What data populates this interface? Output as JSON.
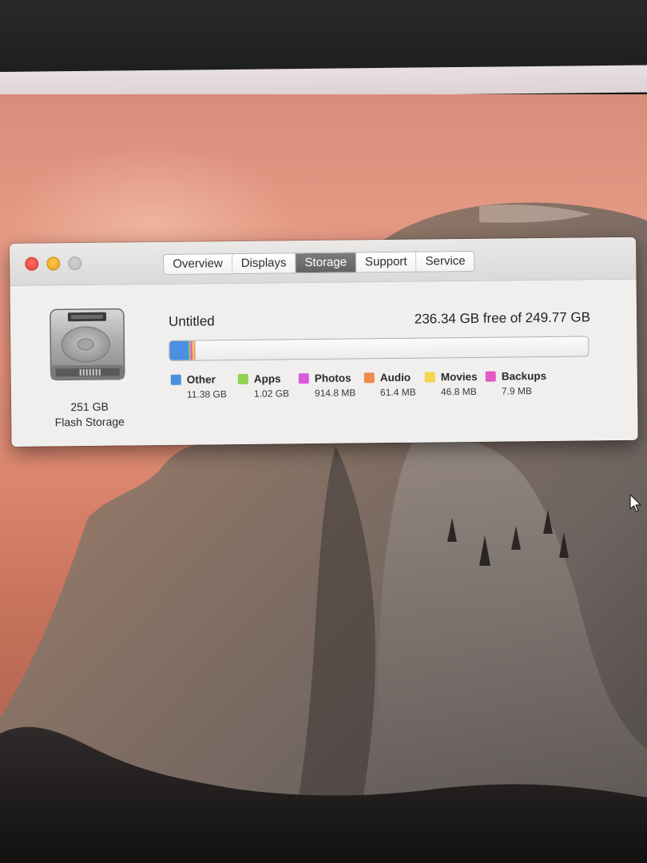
{
  "window": {
    "tabs": [
      {
        "label": "Overview",
        "active": false
      },
      {
        "label": "Displays",
        "active": false
      },
      {
        "label": "Storage",
        "active": true
      },
      {
        "label": "Support",
        "active": false
      },
      {
        "label": "Service",
        "active": false
      }
    ]
  },
  "drive": {
    "capacity": "251 GB",
    "type": "Flash Storage",
    "icon": "hard-drive-icon"
  },
  "volume": {
    "name": "Untitled",
    "free_text": "236.34 GB free of 249.77 GB"
  },
  "storage_bar": {
    "total_gb": 249.77,
    "free_gb": 236.34
  },
  "categories": [
    {
      "label": "Other",
      "value": "11.38 GB",
      "color": "#4a8fe2",
      "gb": 11.38
    },
    {
      "label": "Apps",
      "value": "1.02 GB",
      "color": "#8fd14f",
      "gb": 1.02
    },
    {
      "label": "Photos",
      "value": "914.8 MB",
      "color": "#d95be0",
      "gb": 0.9148
    },
    {
      "label": "Audio",
      "value": "61.4 MB",
      "color": "#ef8a4c",
      "gb": 0.0614
    },
    {
      "label": "Movies",
      "value": "46.8 MB",
      "color": "#f2d54a",
      "gb": 0.0468
    },
    {
      "label": "Backups",
      "value": "7.9 MB",
      "color": "#e25bc4",
      "gb": 0.0079
    }
  ],
  "colors": {
    "active_tab": "#6e6c6a",
    "close": "#ff5f56",
    "minimize": "#ffbd2e",
    "zoom": "#c8c6c4"
  }
}
